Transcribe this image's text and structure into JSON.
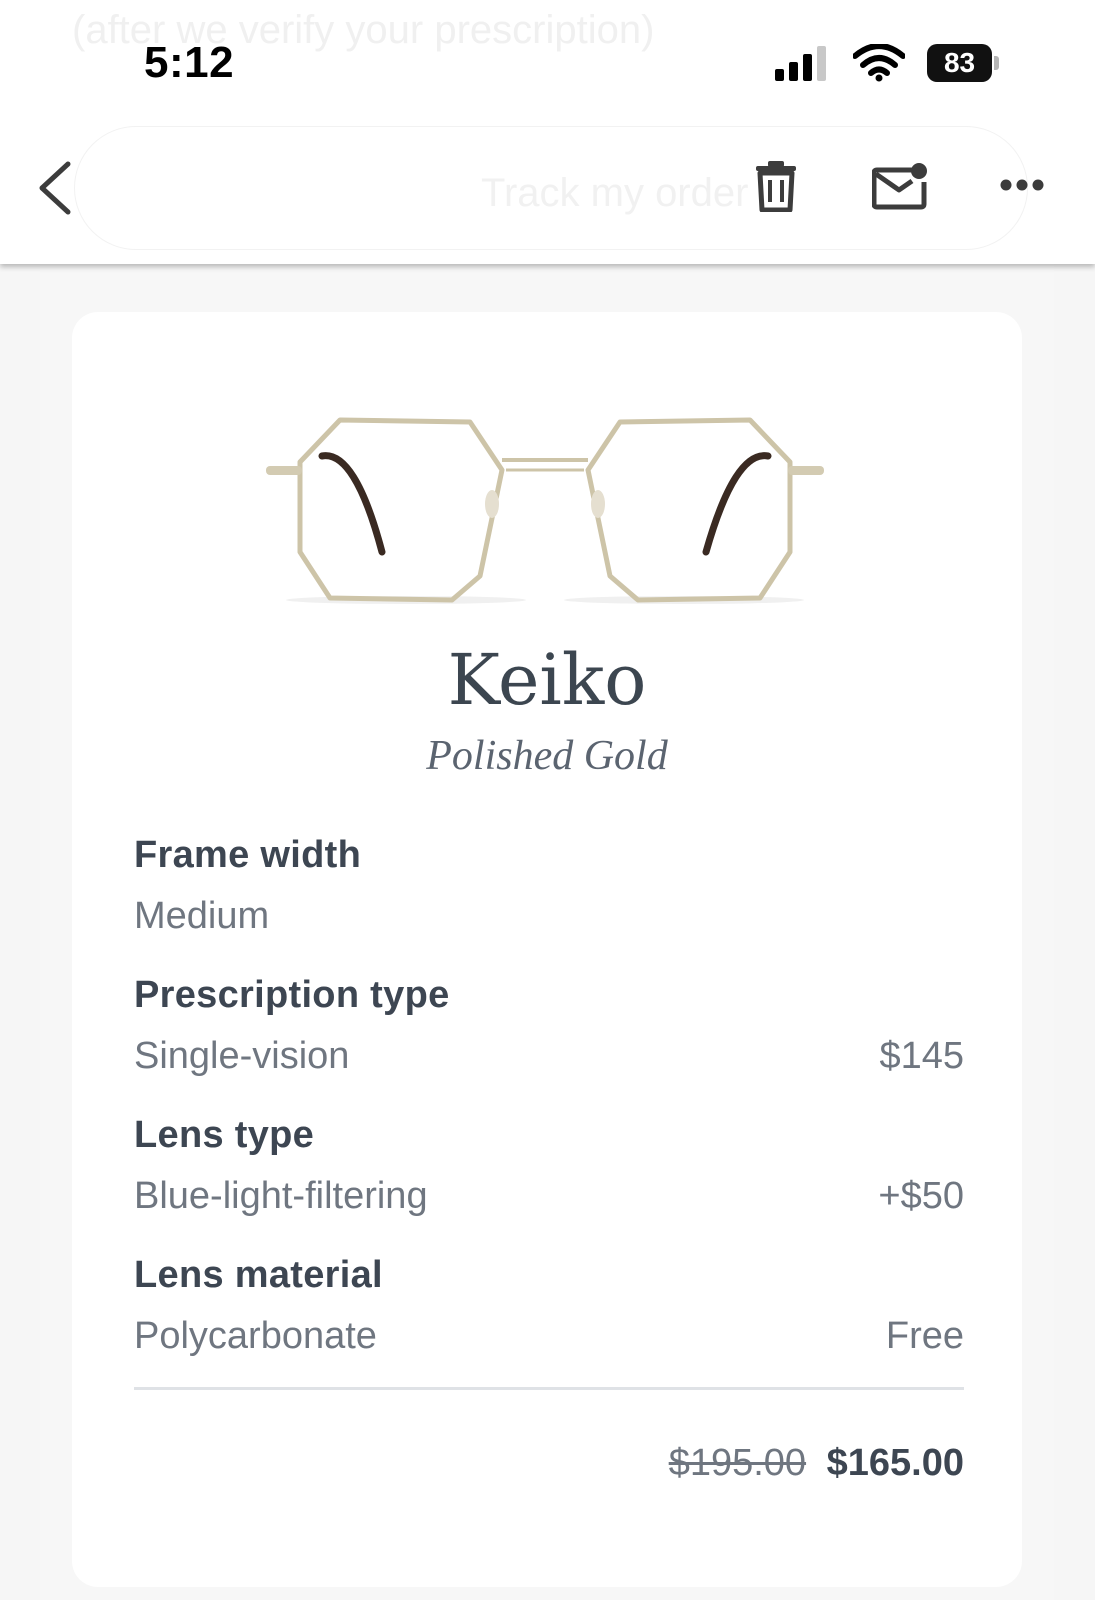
{
  "status_bar": {
    "time": "5:12",
    "battery": "83",
    "behind_text": "(after we verify your prescription)"
  },
  "toolbar": {
    "title_ghost": "Track my order",
    "icons": [
      "back-icon",
      "trash-icon",
      "mail-unread-icon",
      "more-icon"
    ]
  },
  "product": {
    "name": "Keiko",
    "color": "Polished Gold",
    "specs": [
      {
        "label": "Frame width",
        "value": "Medium",
        "price": ""
      },
      {
        "label": "Prescription type",
        "value": "Single-vision",
        "price": "$145"
      },
      {
        "label": "Lens type",
        "value": "Blue-light-filtering",
        "price": "+$50"
      },
      {
        "label": "Lens material",
        "value": "Polycarbonate",
        "price": "Free"
      }
    ],
    "original_price": "$195.00",
    "final_price": "$165.00"
  },
  "colors": {
    "text_dark": "#3d4652",
    "text_muted": "#6f7680",
    "frame_gold": "#cfc6ad",
    "temple_tortoise": "#3a2a22"
  }
}
